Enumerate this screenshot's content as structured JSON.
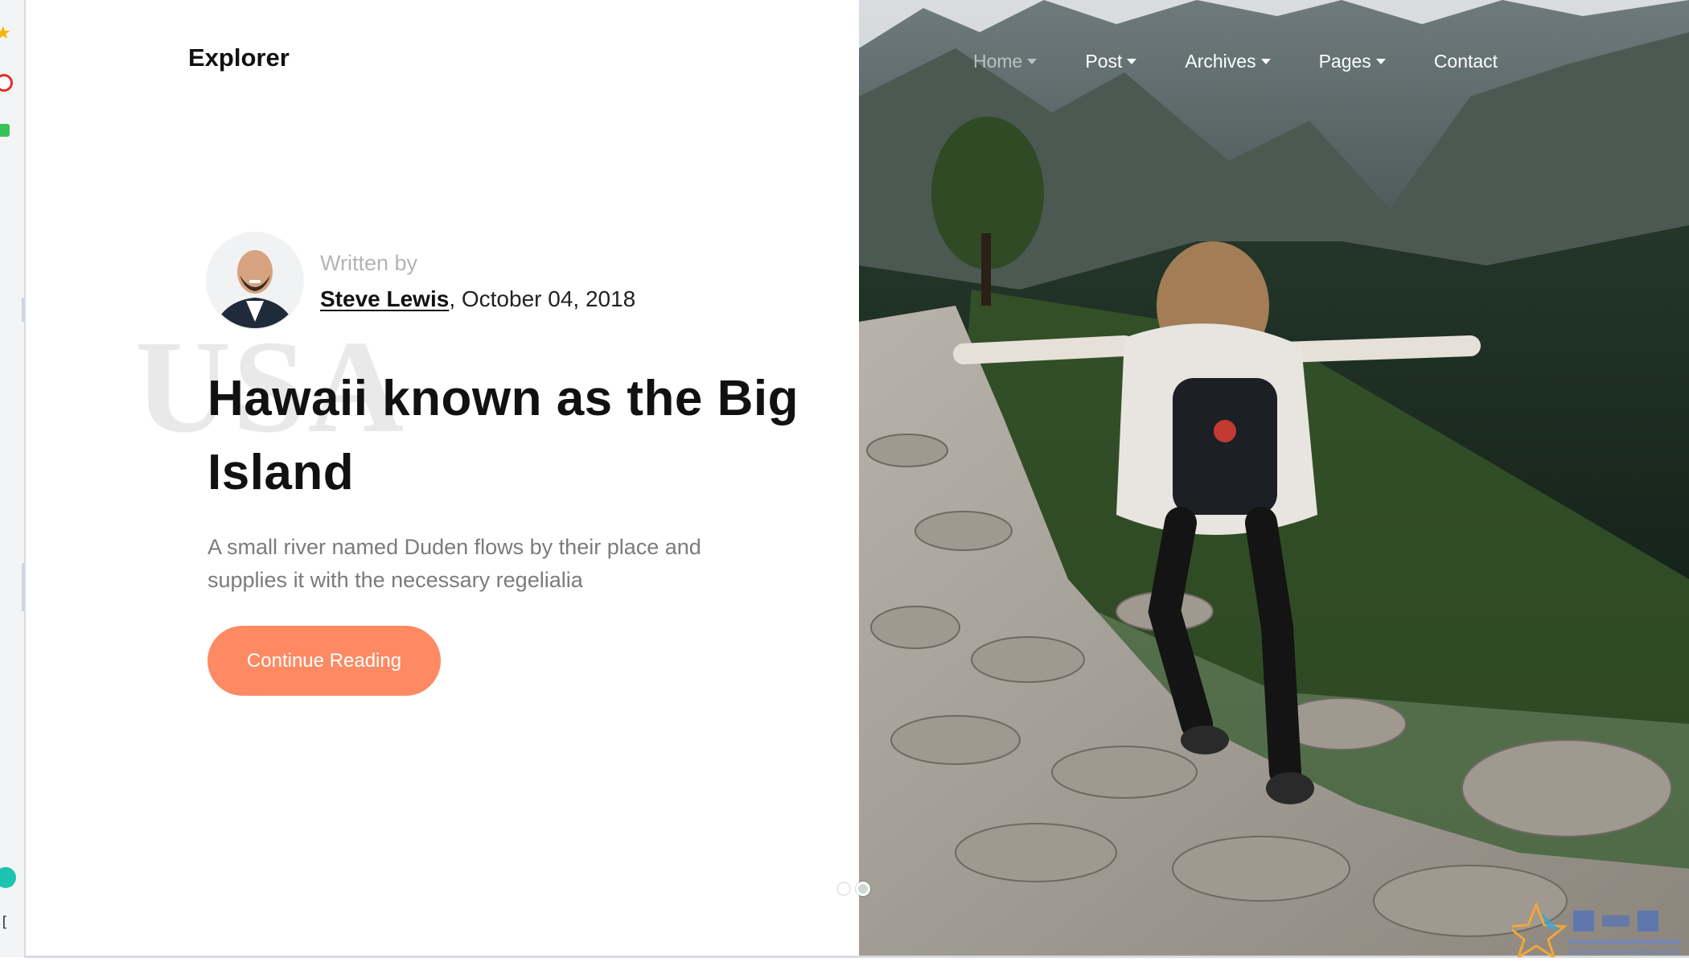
{
  "site": {
    "brand": "Explorer"
  },
  "nav": {
    "items": [
      {
        "label": "Home",
        "dropdown": true,
        "active": true
      },
      {
        "label": "Post",
        "dropdown": true,
        "active": false
      },
      {
        "label": "Archives",
        "dropdown": true,
        "active": false
      },
      {
        "label": "Pages",
        "dropdown": true,
        "active": false
      },
      {
        "label": "Contact",
        "dropdown": false,
        "active": false
      }
    ]
  },
  "post": {
    "written_by_label": "Written by",
    "author": "Steve Lewis",
    "date": ", October 04, 2018",
    "watermark": "USA",
    "title": "Hawaii known as the Big Island",
    "excerpt": "A small river named Duden flows by their place and supplies it with the necessary regelialia",
    "cta_label": "Continue Reading"
  },
  "carousel": {
    "slide_count": 2,
    "active_index": 1
  },
  "colors": {
    "accent": "#fd8a63",
    "text_dark": "#111111",
    "text_muted": "#7b7b7b",
    "watermark": "#e9e9e9"
  },
  "icons": {
    "browser_sidebar": [
      "star-icon",
      "weibo-icon",
      "green-app-icon",
      "teal-app-icon"
    ],
    "hero_image": "mountain-hiker-photo"
  }
}
